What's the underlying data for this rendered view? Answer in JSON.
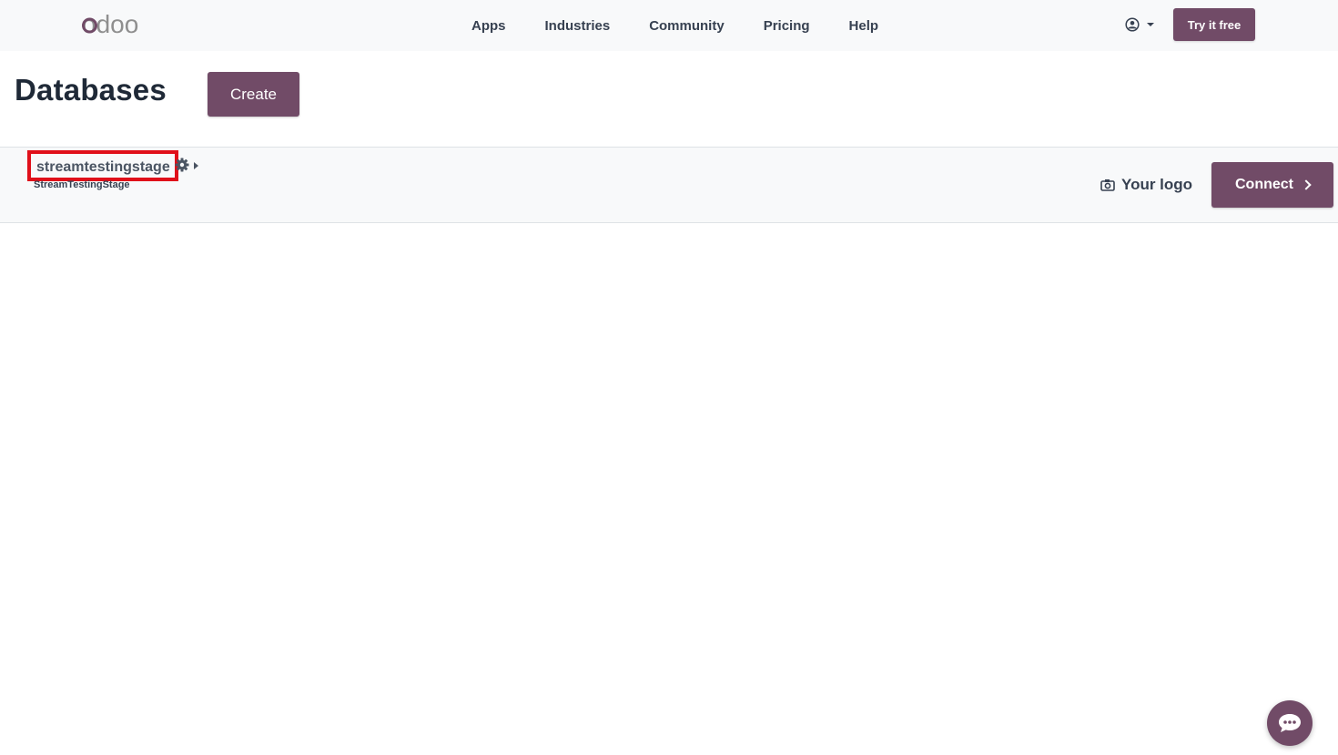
{
  "brand": {
    "logo_text": "odoo",
    "accent_color": "#714b67"
  },
  "nav": {
    "items": [
      {
        "label": "Apps"
      },
      {
        "label": "Industries"
      },
      {
        "label": "Community"
      },
      {
        "label": "Pricing"
      },
      {
        "label": "Help"
      }
    ],
    "user_icon": "user-circle-icon",
    "try_label": "Try it free"
  },
  "header": {
    "title": "Databases",
    "create_label": "Create"
  },
  "database": {
    "name": "streamtestingstage",
    "subtitle": "StreamTestingStage",
    "settings_icon": "gear-icon",
    "expand_icon": "caret-right-icon",
    "logo_link_label": "Your logo",
    "logo_link_icon": "camera-icon",
    "connect_label": "Connect",
    "highlight_color": "#e0101a"
  },
  "chat": {
    "icon": "chat-bubble-icon"
  }
}
